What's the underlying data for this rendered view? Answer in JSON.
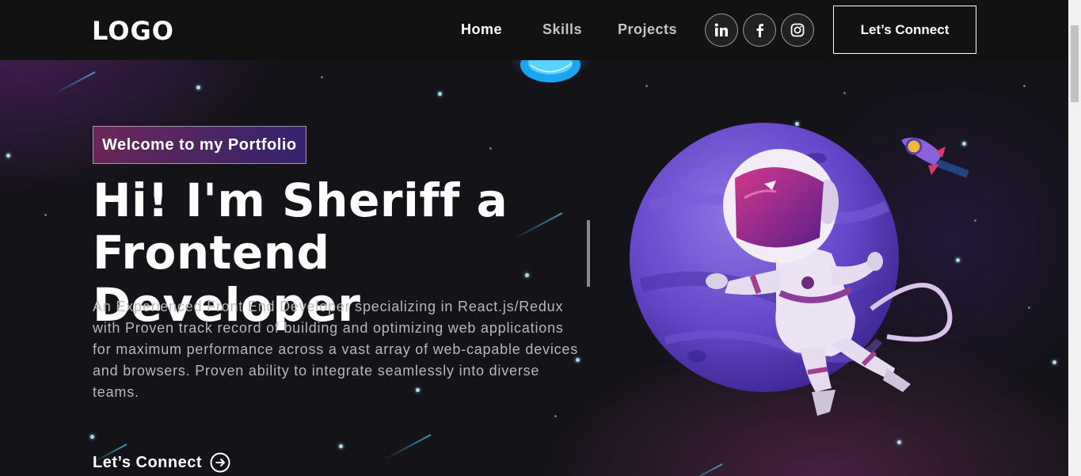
{
  "navbar": {
    "logo": "LOGO",
    "links": [
      {
        "label": "Home"
      },
      {
        "label": "Skills"
      },
      {
        "label": "Projects"
      }
    ],
    "social": [
      "linkedin-icon",
      "facebook-icon",
      "instagram-icon"
    ],
    "connect_label": "Let’s Connect"
  },
  "hero": {
    "tagline": "Welcome to my Portfolio",
    "headline_line1": "Hi! I'm Sheriff a",
    "headline_line2": "Frontend Developer",
    "description": "An Experienced Front End Developer specializing in React.js/Redux with Proven track record of building and optimizing web applications for maximum performance across a vast array of web-capable devices and browsers. Proven ability to integrate seamlessly into diverse teams.",
    "cta_label": "Let’s Connect"
  },
  "colors": {
    "background": "#121212",
    "tagline_gradient_start": "#aa367c",
    "tagline_gradient_end": "#4a2fbd",
    "planet": "#6b4fc8",
    "star": "#a6dcef"
  }
}
